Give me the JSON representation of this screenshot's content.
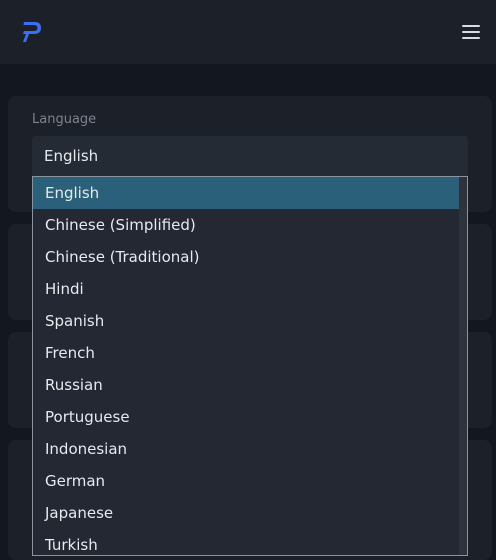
{
  "header": {
    "logo_icon": "p-logo-icon",
    "menu_icon": "hamburger-menu-icon",
    "accent_color": "#3b6ef5"
  },
  "language": {
    "label": "Language",
    "selected": "English",
    "options": [
      "English",
      "Chinese (Simplified)",
      "Chinese (Traditional)",
      "Hindi",
      "Spanish",
      "French",
      "Russian",
      "Portuguese",
      "Indonesian",
      "German",
      "Japanese",
      "Turkish"
    ]
  }
}
